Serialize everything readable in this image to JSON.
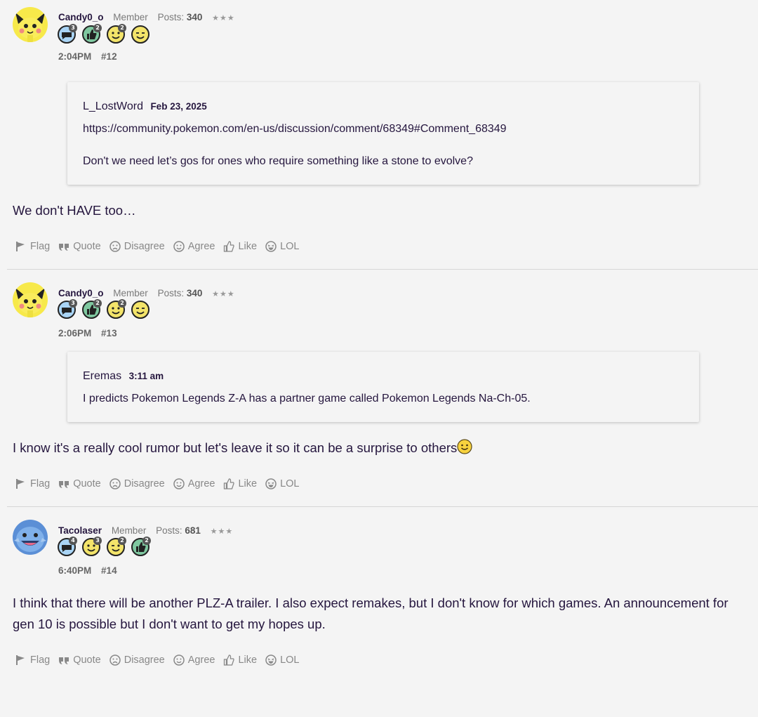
{
  "actions": {
    "flag": "Flag",
    "quote": "Quote",
    "disagree": "Disagree",
    "agree": "Agree",
    "like": "Like",
    "lol": "LOL"
  },
  "comments": [
    {
      "author": "Candy0_o",
      "role": "Member",
      "posts_label": "Posts:",
      "posts": "340",
      "rank": "★★★",
      "avatar_icon": "pichu-avatar",
      "badges": [
        {
          "icon": "comment-badge-icon",
          "count": "3",
          "color": "#a9d4f5"
        },
        {
          "icon": "thumbs-badge-icon",
          "count": "2",
          "color": "#7fc8a0"
        },
        {
          "icon": "smile-badge-icon",
          "count": "2",
          "color": "#f3e46a"
        },
        {
          "icon": "wink-badge-icon",
          "count": "",
          "color": "#f3e46a"
        }
      ],
      "time": "2:04PM",
      "number": "#12",
      "quote": {
        "author": "L_LostWord",
        "date": "Feb 23, 2025",
        "paragraphs": [
          "https://community.pokemon.com/en-us/discussion/comment/68349#Comment_68349",
          "Don't we need let’s gos for ones who require something like a stone to evolve?"
        ]
      },
      "body": "We don't HAVE too…"
    },
    {
      "author": "Candy0_o",
      "role": "Member",
      "posts_label": "Posts:",
      "posts": "340",
      "rank": "★★★",
      "avatar_icon": "pichu-avatar",
      "badges": [
        {
          "icon": "comment-badge-icon",
          "count": "3",
          "color": "#a9d4f5"
        },
        {
          "icon": "thumbs-badge-icon",
          "count": "2",
          "color": "#7fc8a0"
        },
        {
          "icon": "smile-badge-icon",
          "count": "2",
          "color": "#f3e46a"
        },
        {
          "icon": "wink-badge-icon",
          "count": "",
          "color": "#f3e46a"
        }
      ],
      "time": "2:06PM",
      "number": "#13",
      "quote": {
        "author": "Eremas",
        "date": "3:11 am",
        "paragraphs": [
          "I predicts Pokemon Legends Z-A has a partner game called Pokemon Legends Na-Ch-05."
        ]
      },
      "body": "I know it's a really cool rumor but let's leave it so it can be a surprise to others"
    },
    {
      "author": "Tacolaser",
      "role": "Member",
      "posts_label": "Posts:",
      "posts": "681",
      "rank": "★★★",
      "avatar_icon": "wooper-avatar",
      "badges": [
        {
          "icon": "comment-badge-icon",
          "count": "4",
          "color": "#a9d4f5"
        },
        {
          "icon": "smile-badge-icon",
          "count": "3",
          "color": "#f3e46a"
        },
        {
          "icon": "wink-badge-icon",
          "count": "2",
          "color": "#f3e46a"
        },
        {
          "icon": "thumbs-badge-icon",
          "count": "2",
          "color": "#7fc8a0"
        }
      ],
      "time": "6:40PM",
      "number": "#14",
      "body": "I think that there will be another PLZ-A trailer. I also expect remakes, but I don't know for which games. An announcement for gen 10 is possible but I don't want to get my hopes up."
    }
  ]
}
